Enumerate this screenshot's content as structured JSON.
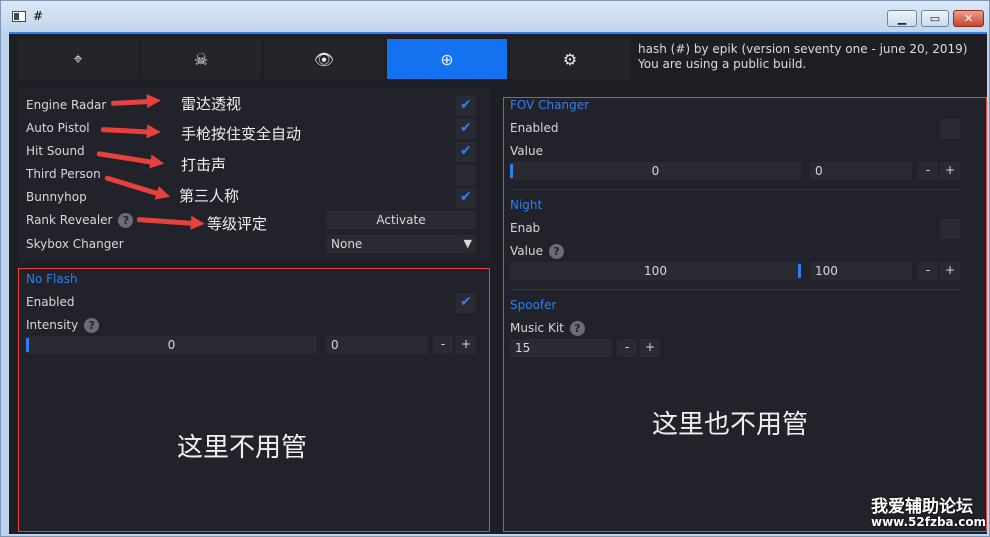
{
  "window": {
    "title": "#"
  },
  "tabs": [
    {
      "icon": "crosshair-icon",
      "glyph": "⌖"
    },
    {
      "icon": "skull-icon",
      "glyph": "☠"
    },
    {
      "icon": "eye-icon",
      "glyph": "👁"
    },
    {
      "icon": "plus-circle-icon",
      "glyph": "⊕",
      "active": true
    },
    {
      "icon": "gears-icon",
      "glyph": "⚙"
    }
  ],
  "header": {
    "line1": "hash (#) by epik (version seventy one - june 20, 2019)",
    "line2": "You are using a public build."
  },
  "misc": {
    "engine_radar": "Engine Radar",
    "auto_pistol": "Auto Pistol",
    "hit_sound": "Hit Sound",
    "third_person": "Third Person",
    "bunnyhop": "Bunnyhop",
    "rank_revealer": "Rank Revealer",
    "rank_button": "Activate",
    "skybox_changer": "Skybox Changer",
    "skybox_value": "None"
  },
  "noflash": {
    "title": "No Flash",
    "enabled": "Enabled",
    "intensity": "Intensity",
    "slider_value": "0",
    "input_value": "0",
    "minus": "-",
    "plus": "+"
  },
  "fov": {
    "title": "FOV Changer",
    "enabled": "Enabled",
    "value_label": "Value",
    "slider_value": "0",
    "input_value": "0",
    "minus": "-",
    "plus": "+"
  },
  "night": {
    "title": "Night",
    "enabled": "Enab",
    "value_label": "Value",
    "slider_value": "100",
    "input_value": "100",
    "minus": "-",
    "plus": "+"
  },
  "spoofer": {
    "title": "Spoofer",
    "music_kit": "Music Kit",
    "value": "15",
    "minus": "-",
    "plus": "+"
  },
  "annotations": {
    "a1": "雷达透视",
    "a2": "手枪按住变全自动",
    "a3": "打击声",
    "a4": "第三人称",
    "a5": "等级评定",
    "left_note": "这里不用管",
    "right_note": "这里也不用管"
  },
  "watermark": {
    "line1": "我爱辅助论坛",
    "line2": "www.52fzba.com"
  },
  "colors": {
    "accent": "#2f7ff0",
    "annotation_red": "#e8413d",
    "panel": "#22232a"
  }
}
